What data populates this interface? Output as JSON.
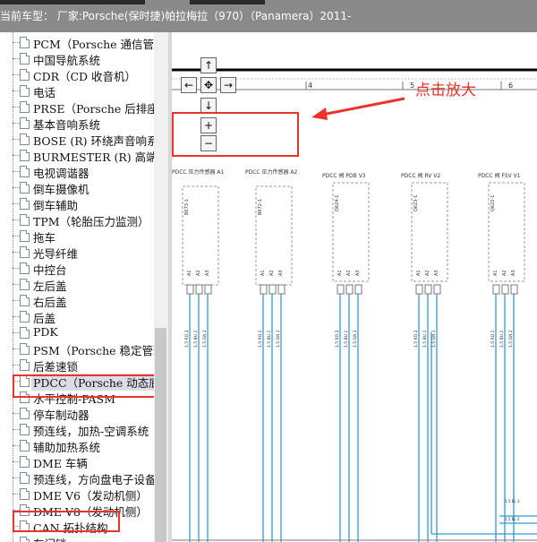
{
  "header": {
    "title": "当前车型： 厂家:Porsche(保时捷)帕拉梅拉（970）（Panamera）2011-"
  },
  "sidebar": {
    "items": [
      {
        "label": "PCM（Porsche 通信管理"
      },
      {
        "label": "中国导航系统"
      },
      {
        "label": "CDR（CD 收音机）"
      },
      {
        "label": "电话"
      },
      {
        "label": "PRSE（Porsche 后排座椅"
      },
      {
        "label": "基本音响系统"
      },
      {
        "label": "BOSE (R) 环绕声音响系统"
      },
      {
        "label": "BURMESTER (R) 高端环"
      },
      {
        "label": "电视调谐器"
      },
      {
        "label": "倒车摄像机"
      },
      {
        "label": "倒车辅助"
      },
      {
        "label": "TPM（轮胎压力监测）"
      },
      {
        "label": "拖车"
      },
      {
        "label": "光导纤维"
      },
      {
        "label": "中控台"
      },
      {
        "label": "左后盖"
      },
      {
        "label": "右后盖"
      },
      {
        "label": "后盖"
      },
      {
        "label": "PDK"
      },
      {
        "label": "PSM（Porsche 稳定管理"
      },
      {
        "label": "后差速锁"
      },
      {
        "label": "PDCC（Porsche 动态底盘"
      },
      {
        "label": "水平控制-PASM"
      },
      {
        "label": "停车制动器"
      },
      {
        "label": "预连线，加热-空调系统"
      },
      {
        "label": "辅助加热系统"
      },
      {
        "label": "DME 车辆"
      },
      {
        "label": "预连线，方向盘电子设备"
      },
      {
        "label": "DME V6（发动机侧）"
      },
      {
        "label": "DME V8（发动机侧）"
      },
      {
        "label": "CAN 拓扑结构"
      },
      {
        "label": "车门锁"
      }
    ]
  },
  "toolbar": {
    "up": "↑",
    "down": "↓",
    "left": "←",
    "right": "→",
    "center": "✥",
    "zoom_in": "+",
    "zoom_out": "−"
  },
  "annotation": {
    "text": "点击放大"
  },
  "diagram": {
    "ruler": [
      "4",
      "5",
      "6"
    ],
    "components": [
      {
        "label": "PDCC 压力传感器 A1",
        "id": "B673-1"
      },
      {
        "label": "PDCC 压力传感器 A2",
        "id": "B672-1"
      },
      {
        "label": "PDCC 阀 PDB V3",
        "id": "Q624-1"
      },
      {
        "label": "PDCC 阀 RV V2",
        "id": "Q623-1"
      },
      {
        "label": "PDCC 阀 FSV V1",
        "id": "Q622-1"
      }
    ],
    "pins": [
      "A1",
      "A2",
      "A3"
    ],
    "wire_labels": [
      "1.5 RD 2",
      "1.5 BU 2",
      "1.5 GN 2"
    ],
    "bus_labels": [
      "1.5 BL 3",
      "1.5 BL 3"
    ]
  },
  "colors": {
    "accent": "#e8342b",
    "wire": "#2f9ad9",
    "topbar": "#8a8a8a"
  }
}
